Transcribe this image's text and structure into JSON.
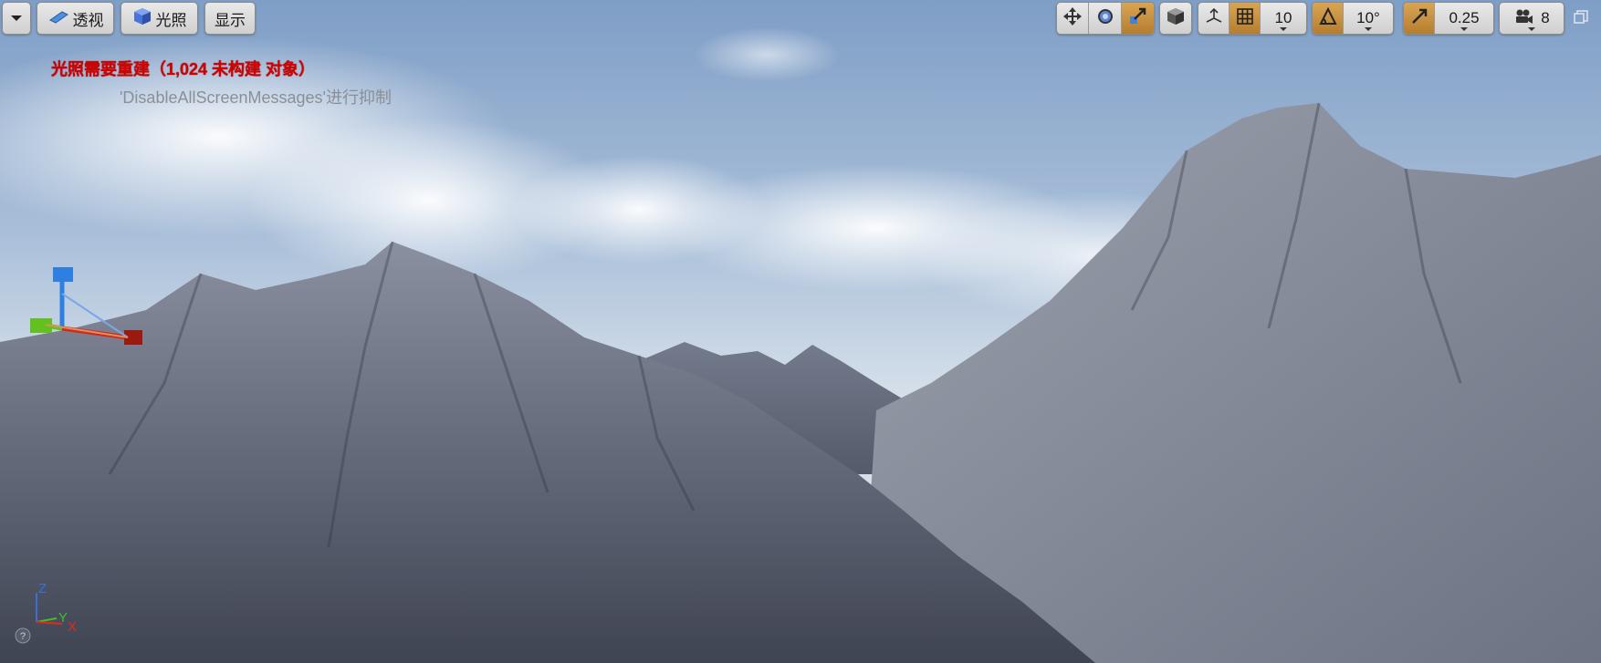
{
  "toolbar": {
    "menu_dropdown": {
      "icon": "chevron-down-icon"
    },
    "perspective": {
      "label": "透视",
      "icon": "perspective-icon"
    },
    "lighting": {
      "label": "光照",
      "icon": "lit-cube-icon"
    },
    "show": {
      "label": "显示"
    },
    "transform_tools": {
      "translate_icon": "move-arrows-icon",
      "rotate_icon": "rotate-icon",
      "scale_icon": "scale-icon",
      "active": "scale"
    },
    "coordinate_system_icon": "world-cube-icon",
    "surface_snap_icon": "surface-snap-icon",
    "grid_snap": {
      "icon": "grid-icon",
      "enabled": true,
      "value": "10"
    },
    "rotation_snap": {
      "icon": "angle-icon",
      "enabled": true,
      "value": "10°"
    },
    "scale_snap": {
      "icon": "scale-arrow-icon",
      "enabled": true,
      "value": "0.25"
    },
    "camera_speed": {
      "icon": "camera-icon",
      "value": "8"
    },
    "maximize_icon": "restore-viewport-icon"
  },
  "messages": {
    "warning": "光照需要重建（1,024 未构建 对象）",
    "hint": "'DisableAllScreenMessages'进行抑制"
  },
  "axis_indicator": {
    "x": "X",
    "y": "Y",
    "z": "Z"
  },
  "colors": {
    "accent": "#c08a3a",
    "warning": "#d40000",
    "sky_top": "#7e9cc4",
    "terrain": "#7f8593"
  }
}
